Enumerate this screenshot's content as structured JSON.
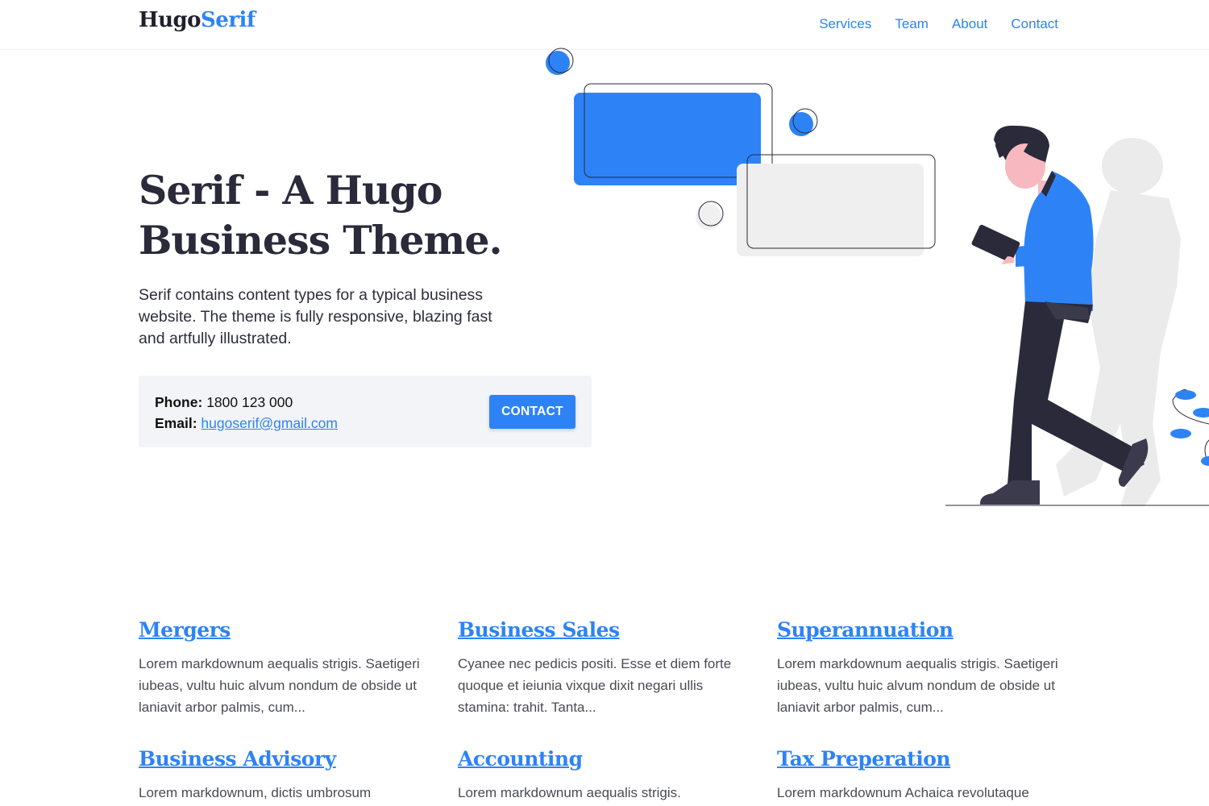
{
  "header": {
    "logo_part1": "Hugo",
    "logo_part2": "Serif",
    "nav": [
      "Services",
      "Team",
      "About",
      "Contact"
    ]
  },
  "hero": {
    "title": "Serif - A Hugo Business Theme.",
    "subtitle": "Serif contains content types for a typical business website. The theme is fully responsive, blazing fast and artfully illustrated.",
    "phone_label": "Phone:",
    "phone": "1800 123 000",
    "email_label": "Email:",
    "email": "hugoserif@gmail.com",
    "contact_button": "CONTACT"
  },
  "services": [
    {
      "title": "Mergers",
      "text": "Lorem markdownum aequalis strigis. Saetigeri iubeas, vultu huic alvum nondum de obside ut laniavit arbor palmis, cum..."
    },
    {
      "title": "Business Sales",
      "text": "Cyanee nec pedicis positi. Esse et diem forte quoque et ieiunia vixque dixit negari ullis stamina: trahit. Tanta..."
    },
    {
      "title": "Superannuation",
      "text": "Lorem markdownum aequalis strigis. Saetigeri iubeas, vultu huic alvum nondum de obside ut laniavit arbor palmis, cum..."
    },
    {
      "title": "Business Advisory",
      "text": "Lorem markdownum, dictis umbrosum"
    },
    {
      "title": "Accounting",
      "text": "Lorem markdownum aequalis strigis."
    },
    {
      "title": "Tax Preperation",
      "text": "Lorem markdownum Achaica revolutaque"
    }
  ],
  "colors": {
    "accent": "#2d83f6",
    "text_dark": "#2a2a3a",
    "box_bg": "#f3f4f8"
  }
}
